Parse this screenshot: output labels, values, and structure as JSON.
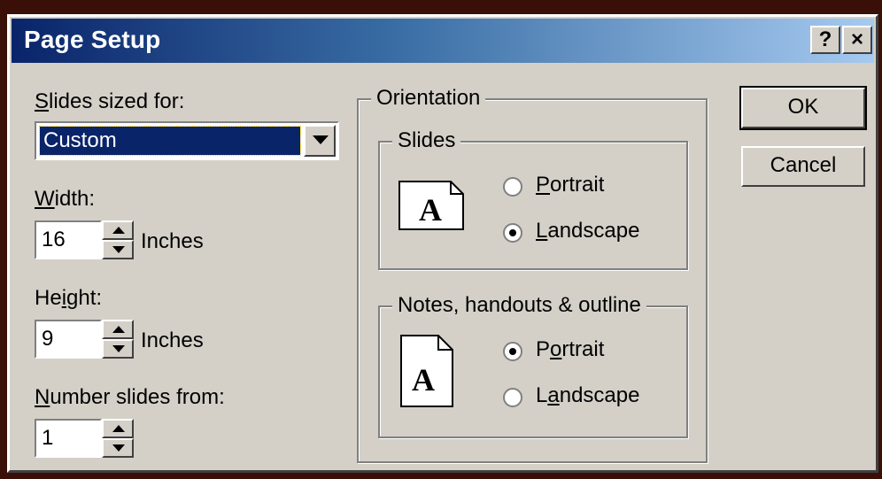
{
  "window": {
    "title": "Page Setup",
    "help_label": "?",
    "close_label": "×"
  },
  "slides_sized_for": {
    "label": "Slides sized for:",
    "value": "Custom"
  },
  "width": {
    "label": "Width:",
    "value": "16",
    "unit": "Inches"
  },
  "height": {
    "label": "Height:",
    "value": "9",
    "unit": "Inches"
  },
  "number_from": {
    "label": "Number slides from:",
    "value": "1"
  },
  "orientation": {
    "label": "Orientation",
    "slides": {
      "label": "Slides",
      "portrait": "Portrait",
      "landscape": "Landscape",
      "selected": "landscape"
    },
    "notes": {
      "label": "Notes, handouts & outline",
      "portrait": "Portrait",
      "landscape": "Landscape",
      "selected": "portrait"
    },
    "icon_letter": "A"
  },
  "buttons": {
    "ok": "OK",
    "cancel": "Cancel"
  }
}
